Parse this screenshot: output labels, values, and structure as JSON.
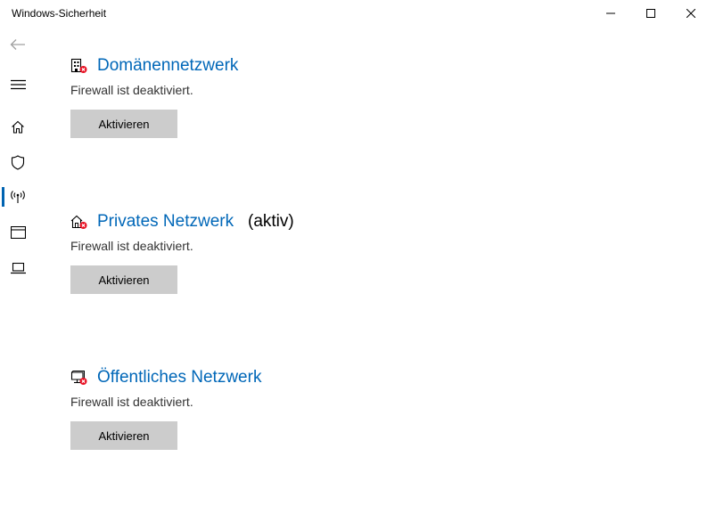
{
  "window": {
    "title": "Windows-Sicherheit",
    "controls": [
      "minimize-icon",
      "maximize-icon",
      "close-icon"
    ]
  },
  "nav": {
    "items": [
      {
        "icon": "back-arrow-icon",
        "enabled": false
      },
      {
        "icon": "hamburger-menu-icon"
      },
      {
        "icon": "home-icon"
      },
      {
        "icon": "shield-icon"
      },
      {
        "icon": "network-antenna-icon",
        "selected": true
      },
      {
        "icon": "app-browser-icon"
      },
      {
        "icon": "laptop-icon"
      }
    ],
    "accent_color": "#0063b1"
  },
  "networks": [
    {
      "title": "Domänennetzwerk",
      "suffix": "",
      "status": "Firewall ist deaktiviert.",
      "button_label": "Aktivieren",
      "icon": "domain-network-error-icon"
    },
    {
      "title": "Privates Netzwerk",
      "suffix": "(aktiv)",
      "status": "Firewall ist deaktiviert.",
      "button_label": "Aktivieren",
      "icon": "private-network-error-icon"
    },
    {
      "title": "Öffentliches Netzwerk",
      "suffix": "",
      "status": "Firewall ist deaktiviert.",
      "button_label": "Aktivieren",
      "icon": "public-network-error-icon"
    }
  ],
  "colors": {
    "link": "#0067b8",
    "error_badge": "#e81123",
    "button_bg": "#cccccc"
  }
}
